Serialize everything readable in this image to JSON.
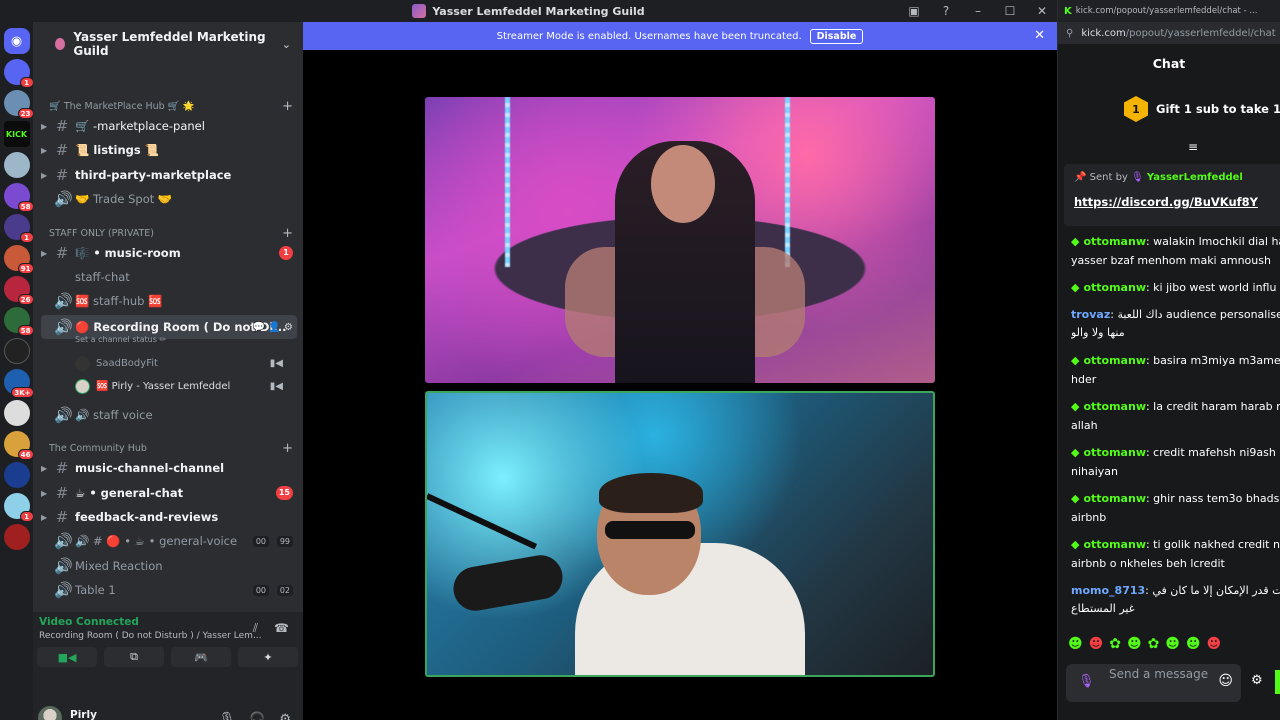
{
  "window": {
    "title": "Yasser Lemfeddel Marketing Guild"
  },
  "banner": {
    "text": "Streamer Mode is enabled. Usernames have been truncated.",
    "button": "Disable"
  },
  "server_rail": {
    "badges": [
      "1",
      "23",
      "58",
      "1",
      "91",
      "26",
      "58",
      "3K+",
      "46",
      "1"
    ],
    "kick_label": "KICK"
  },
  "guild": {
    "name": "Yasser Lemfeddel Marketing Guild"
  },
  "categories": [
    {
      "label": "🛒 The MarketPlace Hub 🛒 🌟"
    },
    {
      "label": "STAFF ONLY (PRIVATE)"
    },
    {
      "label": "The Community Hub"
    }
  ],
  "channels": [
    {
      "label": "🛒 -marketplace-panel"
    },
    {
      "label": "📜 listings 📜"
    },
    {
      "label": "third-party-marketplace"
    },
    {
      "label": "🤝 Trade Spot 🤝"
    },
    {
      "label": "🎼 • music-room",
      "badge": "1"
    },
    {
      "label": "staff-chat"
    },
    {
      "label": "🆘 staff-hub 🆘"
    },
    {
      "label": "🔴 Recording Room ( Do not Di..."
    },
    {
      "label": "🔊 staff voice"
    },
    {
      "label": "music-channel-channel"
    },
    {
      "label": "☕ • general-chat",
      "badge": "15"
    },
    {
      "label": "feedback-and-reviews"
    },
    {
      "label": "🔊 # 🔴 • ☕ • general-voice",
      "pill_a": "00",
      "pill_b": "99"
    },
    {
      "label": "Mixed Reaction"
    },
    {
      "label": "Table 1",
      "pill_a": "00",
      "pill_b": "02"
    }
  ],
  "channel_status": "Set a channel status ✏",
  "voice_users": [
    {
      "name": "SaadBodyFit"
    },
    {
      "name": "🆘 Pirly - Yasser Lemfeddel"
    }
  ],
  "voice_panel": {
    "status": "Video Connected",
    "channel": "Recording Room ( Do not Disturb ) / Yasser Lem..."
  },
  "user": {
    "name": "Pirly"
  },
  "chat": {
    "tab_url": "kick.com/popout/yasserlemfeddel/chat - ...",
    "url_host": "kick.com",
    "url_path": "/popout/yasserlemfeddel/chat",
    "title": "Chat",
    "gift_rank": "1",
    "gift_text": "Gift 1 sub to take 1st",
    "pinned_prefix": "Sent by",
    "pinned_user": "YasserLemfeddel",
    "pinned_link": "https://discord.gg/BuVKuf8Y",
    "messages": [
      {
        "user": "ottomanw",
        "text": ": walakin lmochkil dial ha",
        "line2": "yasser bzaf menhom maki amnoush"
      },
      {
        "user": "ottomanw",
        "text": ": ki jibo west world influ",
        "line2": ""
      },
      {
        "user": "trovaz",
        "text": ": داك اللعبة audience personalise",
        "line2": "منها ولا والو"
      },
      {
        "user": "ottomanw",
        "text": ": basira m3miya m3ame",
        "line2": "hder"
      },
      {
        "user": "ottomanw",
        "text": ": la credit haram harab r",
        "line2": "allah"
      },
      {
        "user": "ottomanw",
        "text": ": credit mafehsh ni9ash",
        "line2": "nihaiyan"
      },
      {
        "user": "ottomanw",
        "text": ": ghir nass tem3o bhads",
        "line2": "airbnb"
      },
      {
        "user": "ottomanw",
        "text": ": ti golik nakhed credit n",
        "line2": "airbnb o nkheles beh lcredit"
      },
      {
        "user": "momo_8713",
        "text": ": الشبهات قدر الإمكان إلا ما كان في",
        "line2": "غير المستطاع"
      }
    ],
    "placeholder": "Send a message"
  },
  "colors": {
    "banner": "#5865f2",
    "kick_green": "#53fc18",
    "connected_green": "#23a55a",
    "sidebar_bg": "#2b2d31"
  }
}
